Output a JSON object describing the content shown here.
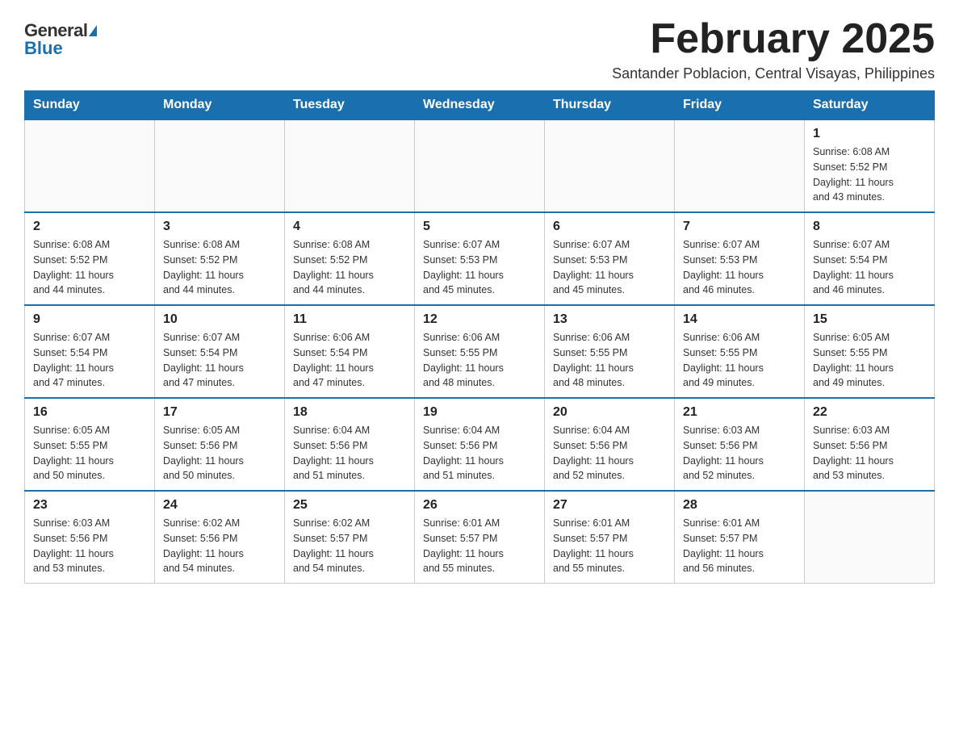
{
  "logo": {
    "general": "General",
    "blue": "Blue"
  },
  "header": {
    "month": "February 2025",
    "location": "Santander Poblacion, Central Visayas, Philippines"
  },
  "weekdays": [
    "Sunday",
    "Monday",
    "Tuesday",
    "Wednesday",
    "Thursday",
    "Friday",
    "Saturday"
  ],
  "weeks": [
    [
      {
        "day": "",
        "info": ""
      },
      {
        "day": "",
        "info": ""
      },
      {
        "day": "",
        "info": ""
      },
      {
        "day": "",
        "info": ""
      },
      {
        "day": "",
        "info": ""
      },
      {
        "day": "",
        "info": ""
      },
      {
        "day": "1",
        "info": "Sunrise: 6:08 AM\nSunset: 5:52 PM\nDaylight: 11 hours\nand 43 minutes."
      }
    ],
    [
      {
        "day": "2",
        "info": "Sunrise: 6:08 AM\nSunset: 5:52 PM\nDaylight: 11 hours\nand 44 minutes."
      },
      {
        "day": "3",
        "info": "Sunrise: 6:08 AM\nSunset: 5:52 PM\nDaylight: 11 hours\nand 44 minutes."
      },
      {
        "day": "4",
        "info": "Sunrise: 6:08 AM\nSunset: 5:52 PM\nDaylight: 11 hours\nand 44 minutes."
      },
      {
        "day": "5",
        "info": "Sunrise: 6:07 AM\nSunset: 5:53 PM\nDaylight: 11 hours\nand 45 minutes."
      },
      {
        "day": "6",
        "info": "Sunrise: 6:07 AM\nSunset: 5:53 PM\nDaylight: 11 hours\nand 45 minutes."
      },
      {
        "day": "7",
        "info": "Sunrise: 6:07 AM\nSunset: 5:53 PM\nDaylight: 11 hours\nand 46 minutes."
      },
      {
        "day": "8",
        "info": "Sunrise: 6:07 AM\nSunset: 5:54 PM\nDaylight: 11 hours\nand 46 minutes."
      }
    ],
    [
      {
        "day": "9",
        "info": "Sunrise: 6:07 AM\nSunset: 5:54 PM\nDaylight: 11 hours\nand 47 minutes."
      },
      {
        "day": "10",
        "info": "Sunrise: 6:07 AM\nSunset: 5:54 PM\nDaylight: 11 hours\nand 47 minutes."
      },
      {
        "day": "11",
        "info": "Sunrise: 6:06 AM\nSunset: 5:54 PM\nDaylight: 11 hours\nand 47 minutes."
      },
      {
        "day": "12",
        "info": "Sunrise: 6:06 AM\nSunset: 5:55 PM\nDaylight: 11 hours\nand 48 minutes."
      },
      {
        "day": "13",
        "info": "Sunrise: 6:06 AM\nSunset: 5:55 PM\nDaylight: 11 hours\nand 48 minutes."
      },
      {
        "day": "14",
        "info": "Sunrise: 6:06 AM\nSunset: 5:55 PM\nDaylight: 11 hours\nand 49 minutes."
      },
      {
        "day": "15",
        "info": "Sunrise: 6:05 AM\nSunset: 5:55 PM\nDaylight: 11 hours\nand 49 minutes."
      }
    ],
    [
      {
        "day": "16",
        "info": "Sunrise: 6:05 AM\nSunset: 5:55 PM\nDaylight: 11 hours\nand 50 minutes."
      },
      {
        "day": "17",
        "info": "Sunrise: 6:05 AM\nSunset: 5:56 PM\nDaylight: 11 hours\nand 50 minutes."
      },
      {
        "day": "18",
        "info": "Sunrise: 6:04 AM\nSunset: 5:56 PM\nDaylight: 11 hours\nand 51 minutes."
      },
      {
        "day": "19",
        "info": "Sunrise: 6:04 AM\nSunset: 5:56 PM\nDaylight: 11 hours\nand 51 minutes."
      },
      {
        "day": "20",
        "info": "Sunrise: 6:04 AM\nSunset: 5:56 PM\nDaylight: 11 hours\nand 52 minutes."
      },
      {
        "day": "21",
        "info": "Sunrise: 6:03 AM\nSunset: 5:56 PM\nDaylight: 11 hours\nand 52 minutes."
      },
      {
        "day": "22",
        "info": "Sunrise: 6:03 AM\nSunset: 5:56 PM\nDaylight: 11 hours\nand 53 minutes."
      }
    ],
    [
      {
        "day": "23",
        "info": "Sunrise: 6:03 AM\nSunset: 5:56 PM\nDaylight: 11 hours\nand 53 minutes."
      },
      {
        "day": "24",
        "info": "Sunrise: 6:02 AM\nSunset: 5:56 PM\nDaylight: 11 hours\nand 54 minutes."
      },
      {
        "day": "25",
        "info": "Sunrise: 6:02 AM\nSunset: 5:57 PM\nDaylight: 11 hours\nand 54 minutes."
      },
      {
        "day": "26",
        "info": "Sunrise: 6:01 AM\nSunset: 5:57 PM\nDaylight: 11 hours\nand 55 minutes."
      },
      {
        "day": "27",
        "info": "Sunrise: 6:01 AM\nSunset: 5:57 PM\nDaylight: 11 hours\nand 55 minutes."
      },
      {
        "day": "28",
        "info": "Sunrise: 6:01 AM\nSunset: 5:57 PM\nDaylight: 11 hours\nand 56 minutes."
      },
      {
        "day": "",
        "info": ""
      }
    ]
  ]
}
